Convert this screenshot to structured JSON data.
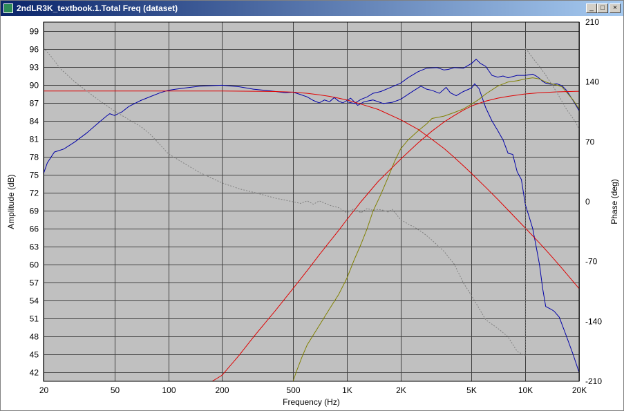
{
  "window": {
    "title": "2ndLR3K_textbook.1.Total Freq (dataset)",
    "controls": {
      "minimize": "_",
      "maximize": "□",
      "close": "×"
    }
  },
  "chart_data": {
    "type": "line",
    "xlabel": "Frequency (Hz)",
    "ylabel": "Amplitude (dB)",
    "y2label": "Phase (deg)",
    "xscale": "log",
    "xlim": [
      20,
      20000
    ],
    "ylim": [
      40.5,
      100.5
    ],
    "y2lim": [
      -210,
      210
    ],
    "grid": true,
    "background": "#c0c0c0",
    "x_ticks": [
      {
        "v": 20,
        "label": "20"
      },
      {
        "v": 50,
        "label": "50"
      },
      {
        "v": 100,
        "label": "100"
      },
      {
        "v": 200,
        "label": "200"
      },
      {
        "v": 500,
        "label": "500"
      },
      {
        "v": 1000,
        "label": "1K"
      },
      {
        "v": 2000,
        "label": "2K"
      },
      {
        "v": 5000,
        "label": "5K"
      },
      {
        "v": 10000,
        "label": "10K"
      },
      {
        "v": 20000,
        "label": "20K"
      }
    ],
    "y_ticks": [
      "99",
      "96",
      "93",
      "90",
      "87",
      "84",
      "81",
      "78",
      "75",
      "72",
      "69",
      "66",
      "63",
      "60",
      "57",
      "54",
      "51",
      "48",
      "45",
      "42"
    ],
    "y2_ticks": [
      "210",
      "140",
      "70",
      "0",
      "-70",
      "-140",
      "-210"
    ],
    "series": [
      {
        "color": "#0000a8",
        "axis": "y",
        "values": [
          [
            20,
            75.2
          ],
          [
            21,
            77
          ],
          [
            23,
            78.8
          ],
          [
            26,
            79.3
          ],
          [
            30,
            80.5
          ],
          [
            35,
            82
          ],
          [
            40,
            83.5
          ],
          [
            45,
            84.8
          ],
          [
            47,
            85.2
          ],
          [
            50,
            84.9
          ],
          [
            55,
            85.5
          ],
          [
            60,
            86.4
          ],
          [
            70,
            87.4
          ],
          [
            80,
            88.1
          ],
          [
            90,
            88.7
          ],
          [
            100,
            89.1
          ],
          [
            110,
            89.3
          ],
          [
            125,
            89.5
          ],
          [
            150,
            89.8
          ],
          [
            180,
            89.9
          ],
          [
            200,
            89.95
          ],
          [
            250,
            89.7
          ],
          [
            300,
            89.3
          ],
          [
            350,
            89.1
          ],
          [
            400,
            88.9
          ],
          [
            450,
            88.7
          ],
          [
            500,
            88.8
          ],
          [
            550,
            88.4
          ],
          [
            600,
            88
          ],
          [
            650,
            87.4
          ],
          [
            700,
            87
          ],
          [
            750,
            87.5
          ],
          [
            800,
            87.2
          ],
          [
            850,
            87.9
          ],
          [
            900,
            87.3
          ],
          [
            950,
            87
          ],
          [
            1000,
            87.4
          ],
          [
            1050,
            87.8
          ],
          [
            1100,
            87.2
          ],
          [
            1150,
            86.6
          ],
          [
            1250,
            87.2
          ],
          [
            1400,
            87.5
          ],
          [
            1600,
            86.9
          ],
          [
            1800,
            87.1
          ],
          [
            2000,
            87.6
          ],
          [
            2300,
            88.8
          ],
          [
            2600,
            89.8
          ],
          [
            2800,
            89.3
          ],
          [
            3000,
            89.1
          ],
          [
            3300,
            88.6
          ],
          [
            3600,
            89.6
          ],
          [
            3800,
            88.7
          ],
          [
            4100,
            88.2
          ],
          [
            4500,
            88.9
          ],
          [
            5000,
            89.5
          ],
          [
            5200,
            90.2
          ],
          [
            5500,
            89.4
          ],
          [
            6000,
            86.2
          ],
          [
            6500,
            84
          ],
          [
            7000,
            82.4
          ],
          [
            7500,
            80.8
          ],
          [
            8000,
            78.6
          ],
          [
            8500,
            78.4
          ],
          [
            9000,
            75.5
          ],
          [
            9500,
            74.2
          ],
          [
            10000,
            70
          ],
          [
            10500,
            68
          ],
          [
            11000,
            66
          ],
          [
            11500,
            63
          ],
          [
            12000,
            60
          ],
          [
            12500,
            56
          ],
          [
            13000,
            53
          ],
          [
            14000,
            52.5
          ],
          [
            14500,
            52.2
          ],
          [
            15500,
            51.2
          ],
          [
            17000,
            48
          ],
          [
            18500,
            45
          ],
          [
            20000,
            42
          ]
        ]
      },
      {
        "color": "#0000a8",
        "axis": "y",
        "values": [
          [
            1000,
            87.2
          ],
          [
            1100,
            86.9
          ],
          [
            1200,
            87.6
          ],
          [
            1300,
            88
          ],
          [
            1400,
            88.6
          ],
          [
            1550,
            88.9
          ],
          [
            1700,
            89.4
          ],
          [
            2000,
            90.3
          ],
          [
            2200,
            91.2
          ],
          [
            2500,
            92.2
          ],
          [
            2800,
            92.8
          ],
          [
            3200,
            92.9
          ],
          [
            3500,
            92.5
          ],
          [
            3700,
            92.6
          ],
          [
            4000,
            92.9
          ],
          [
            4500,
            92.8
          ],
          [
            5000,
            93.6
          ],
          [
            5300,
            94.3
          ],
          [
            5600,
            93.6
          ],
          [
            6000,
            93.1
          ],
          [
            6500,
            91.6
          ],
          [
            7000,
            91.3
          ],
          [
            7500,
            91.5
          ],
          [
            8000,
            91.2
          ],
          [
            9000,
            91.6
          ],
          [
            10000,
            91.6
          ],
          [
            11000,
            91.8
          ],
          [
            11500,
            91.5
          ],
          [
            12000,
            91.1
          ],
          [
            12500,
            90.6
          ],
          [
            13000,
            90.3
          ],
          [
            14000,
            90.1
          ],
          [
            15000,
            90.2
          ],
          [
            16000,
            89.9
          ],
          [
            17000,
            89.1
          ],
          [
            18500,
            87.4
          ],
          [
            20000,
            85.7
          ]
        ]
      },
      {
        "color": "#808000",
        "axis": "y",
        "values": [
          [
            500,
            40.5
          ],
          [
            520,
            42
          ],
          [
            560,
            44.5
          ],
          [
            600,
            46.6
          ],
          [
            700,
            49.8
          ],
          [
            800,
            52.6
          ],
          [
            900,
            55
          ],
          [
            1000,
            57.7
          ],
          [
            1100,
            60.8
          ],
          [
            1200,
            63.4
          ],
          [
            1300,
            66
          ],
          [
            1400,
            68.9
          ],
          [
            1550,
            71.7
          ],
          [
            1700,
            74.5
          ],
          [
            1850,
            77.2
          ],
          [
            2000,
            79.3
          ],
          [
            2200,
            80.8
          ],
          [
            2500,
            82.3
          ],
          [
            2800,
            83.5
          ],
          [
            3000,
            84.4
          ],
          [
            3500,
            84.8
          ],
          [
            4000,
            85.4
          ],
          [
            4500,
            86
          ],
          [
            5000,
            86.8
          ],
          [
            5500,
            87.6
          ],
          [
            6000,
            88.5
          ],
          [
            7000,
            89.8
          ],
          [
            8000,
            90.5
          ],
          [
            9000,
            90.7
          ],
          [
            10000,
            91
          ],
          [
            11000,
            91.2
          ],
          [
            12000,
            91
          ],
          [
            13000,
            90.5
          ],
          [
            14000,
            90.2
          ],
          [
            15000,
            90
          ],
          [
            16000,
            89.7
          ],
          [
            17000,
            88.8
          ],
          [
            18500,
            87.5
          ],
          [
            20000,
            86
          ]
        ]
      },
      {
        "color": "#e00000",
        "axis": "y",
        "values": [
          [
            20,
            89
          ],
          [
            100,
            89
          ],
          [
            200,
            89
          ],
          [
            300,
            88.95
          ],
          [
            400,
            88.9
          ],
          [
            500,
            88.8
          ],
          [
            600,
            88.6
          ],
          [
            700,
            88.35
          ],
          [
            800,
            88.1
          ],
          [
            900,
            87.8
          ],
          [
            1000,
            87.5
          ],
          [
            1200,
            86.8
          ],
          [
            1500,
            85.9
          ],
          [
            2000,
            84.2
          ],
          [
            2500,
            82.6
          ],
          [
            3000,
            80.9
          ],
          [
            3500,
            79.4
          ],
          [
            4000,
            77.9
          ],
          [
            4500,
            76.5
          ],
          [
            5000,
            75.2
          ],
          [
            6000,
            72.9
          ],
          [
            7000,
            70.9
          ],
          [
            8000,
            69.1
          ],
          [
            10000,
            66.1
          ],
          [
            12000,
            63.6
          ],
          [
            14000,
            61.4
          ],
          [
            16000,
            59.4
          ],
          [
            18000,
            57.6
          ],
          [
            20000,
            56
          ]
        ]
      },
      {
        "color": "#e00000",
        "axis": "y",
        "values": [
          [
            176,
            40.5
          ],
          [
            200,
            41.5
          ],
          [
            250,
            44.9
          ],
          [
            300,
            47.9
          ],
          [
            400,
            52.4
          ],
          [
            500,
            56
          ],
          [
            600,
            59
          ],
          [
            700,
            61.6
          ],
          [
            800,
            63.8
          ],
          [
            900,
            65.7
          ],
          [
            1000,
            67.5
          ],
          [
            1200,
            70.5
          ],
          [
            1500,
            73.9
          ],
          [
            2000,
            77.6
          ],
          [
            2500,
            80.3
          ],
          [
            3000,
            82.3
          ],
          [
            3500,
            83.8
          ],
          [
            4000,
            84.9
          ],
          [
            4500,
            85.8
          ],
          [
            5000,
            86.5
          ],
          [
            6000,
            87.3
          ],
          [
            7000,
            87.8
          ],
          [
            8000,
            88.1
          ],
          [
            10000,
            88.5
          ],
          [
            12000,
            88.7
          ],
          [
            15000,
            88.85
          ],
          [
            20000,
            88.95
          ]
        ]
      },
      {
        "color": "#808080",
        "axis": "y2",
        "dashed": true,
        "values": [
          [
            20,
            180
          ],
          [
            22,
            170
          ],
          [
            25,
            155
          ],
          [
            30,
            140
          ],
          [
            40,
            120
          ],
          [
            50,
            106
          ],
          [
            60,
            96
          ],
          [
            70,
            88
          ],
          [
            80,
            78
          ],
          [
            100,
            56
          ],
          [
            120,
            46
          ],
          [
            150,
            34
          ],
          [
            200,
            22
          ],
          [
            250,
            15
          ],
          [
            300,
            11
          ],
          [
            400,
            4
          ],
          [
            500,
            0
          ],
          [
            550,
            -2
          ],
          [
            600,
            1
          ],
          [
            650,
            -3
          ],
          [
            700,
            1
          ],
          [
            800,
            -4
          ],
          [
            900,
            -7
          ],
          [
            1000,
            -13
          ],
          [
            1100,
            -8
          ],
          [
            1200,
            -13
          ],
          [
            1300,
            -8
          ],
          [
            1400,
            -10
          ],
          [
            1500,
            -9
          ],
          [
            1600,
            -10
          ],
          [
            1700,
            -12
          ],
          [
            1800,
            -9
          ],
          [
            2000,
            -21
          ],
          [
            2200,
            -26
          ],
          [
            2400,
            -30
          ],
          [
            2700,
            -37
          ],
          [
            3000,
            -45
          ],
          [
            3500,
            -58
          ],
          [
            4000,
            -73
          ],
          [
            4500,
            -95
          ],
          [
            5000,
            -110
          ],
          [
            6000,
            -138
          ],
          [
            7000,
            -148
          ],
          [
            8000,
            -158
          ],
          [
            9000,
            -175
          ],
          [
            10000,
            -180
          ],
          [
            10000,
            180
          ],
          [
            11000,
            168
          ],
          [
            12000,
            158
          ],
          [
            13000,
            148
          ],
          [
            15000,
            128
          ],
          [
            17000,
            108
          ],
          [
            19000,
            94
          ],
          [
            20000,
            85
          ]
        ]
      }
    ]
  }
}
